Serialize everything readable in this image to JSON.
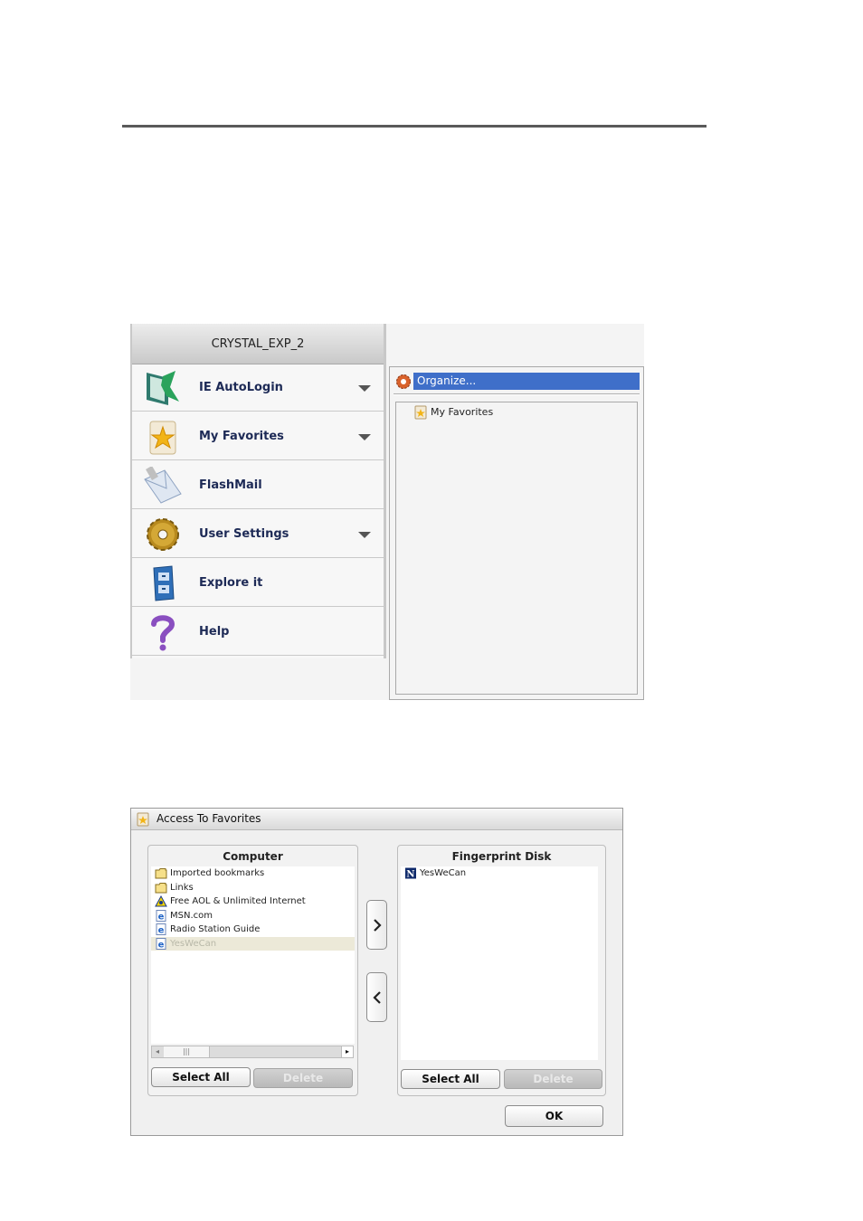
{
  "sidebar": {
    "title": "CRYSTAL_EXP_2",
    "items": [
      {
        "label": "IE AutoLogin",
        "icon": "ie-autologin-icon",
        "has_dropdown": true
      },
      {
        "label": "My Favorites",
        "icon": "favorites-star-icon",
        "has_dropdown": true
      },
      {
        "label": "FlashMail",
        "icon": "mail-envelope-icon",
        "has_dropdown": false
      },
      {
        "label": "User Settings",
        "icon": "gear-icon",
        "has_dropdown": true
      },
      {
        "label": "Explore it",
        "icon": "file-cabinet-icon",
        "has_dropdown": false
      },
      {
        "label": "Help",
        "icon": "question-mark-icon",
        "has_dropdown": false
      }
    ]
  },
  "organize": {
    "menu_label": "Organize...",
    "tree_root": "My Favorites",
    "selection_color": "#3f6fc9"
  },
  "dialog": {
    "title": "Access To Favorites",
    "computer": {
      "header": "Computer",
      "items": [
        {
          "label": "Imported bookmarks",
          "icon": "folder-icon"
        },
        {
          "label": "Links",
          "icon": "folder-icon"
        },
        {
          "label": "Free AOL & Unlimited Internet",
          "icon": "aol-icon"
        },
        {
          "label": "MSN.com",
          "icon": "ie-page-icon"
        },
        {
          "label": "Radio Station Guide",
          "icon": "ie-page-icon"
        },
        {
          "label": "YesWeCan",
          "icon": "ie-page-icon",
          "selected": true
        }
      ],
      "select_all": "Select All",
      "delete": "Delete"
    },
    "fingerprint": {
      "header": "Fingerprint Disk",
      "items": [
        {
          "label": "YesWeCan",
          "icon": "netscape-n-icon"
        }
      ],
      "select_all": "Select All",
      "delete": "Delete"
    },
    "ok": "OK"
  }
}
